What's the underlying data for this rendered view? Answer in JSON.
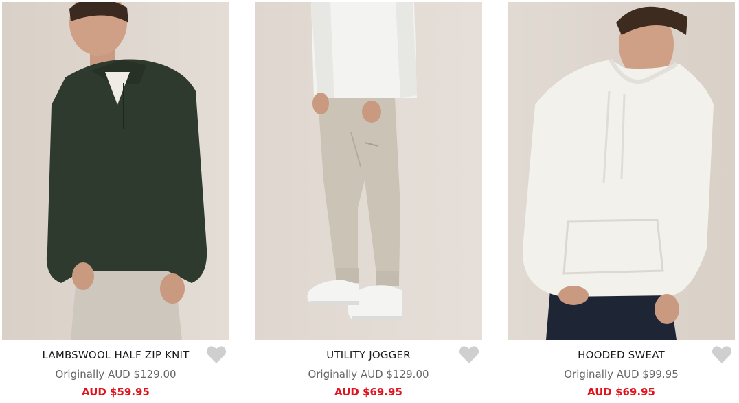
{
  "products": [
    {
      "name": "LAMBSWOOL HALF ZIP KNIT",
      "original_price": "Originally AUD $129.00",
      "sale_price": "AUD $59.95",
      "image_alt": "Man wearing dark green lambswool half zip knit"
    },
    {
      "name": "UTILITY JOGGER",
      "original_price": "Originally AUD $129.00",
      "sale_price": "AUD $69.95",
      "image_alt": "Man wearing stone utility jogger pants"
    },
    {
      "name": "HOODED SWEAT",
      "original_price": "Originally AUD $99.95",
      "sale_price": "AUD $69.95",
      "image_alt": "Man wearing off-white hooded sweat"
    }
  ],
  "colors": {
    "sale_red": "#e0141e",
    "muted_text": "#666666",
    "heart_grey": "#cfcfcf",
    "photo_background": "#ddd5cd"
  },
  "icons": {
    "wishlist": "heart-icon"
  }
}
